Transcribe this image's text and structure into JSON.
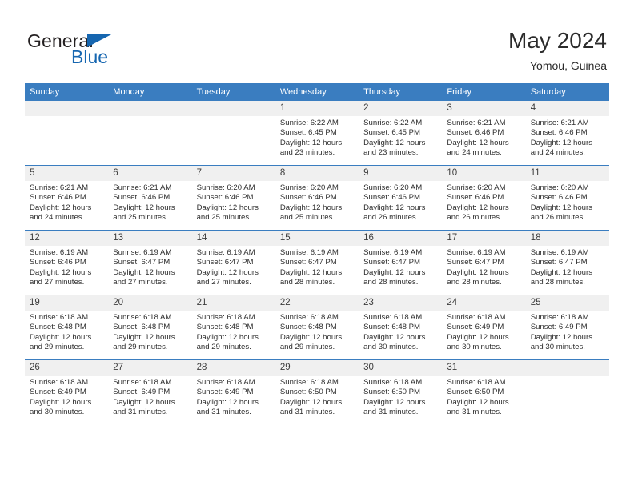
{
  "brand": {
    "name_part1": "General",
    "name_part2": "Blue",
    "color_dark": "#231f20",
    "color_blue": "#1666b0"
  },
  "header": {
    "title": "May 2024",
    "subtitle": "Yomou, Guinea"
  },
  "theme": {
    "header_blue": "#3a7dc0",
    "daynum_gray": "#f0f0f0",
    "text": "#2e2e2e"
  },
  "weekday_headers": [
    "Sunday",
    "Monday",
    "Tuesday",
    "Wednesday",
    "Thursday",
    "Friday",
    "Saturday"
  ],
  "weeks": [
    [
      {
        "day": "",
        "empty": true
      },
      {
        "day": "",
        "empty": true
      },
      {
        "day": "",
        "empty": true
      },
      {
        "day": "1",
        "sunrise": "Sunrise: 6:22 AM",
        "sunset": "Sunset: 6:45 PM",
        "daylight1": "Daylight: 12 hours",
        "daylight2": "and 23 minutes."
      },
      {
        "day": "2",
        "sunrise": "Sunrise: 6:22 AM",
        "sunset": "Sunset: 6:45 PM",
        "daylight1": "Daylight: 12 hours",
        "daylight2": "and 23 minutes."
      },
      {
        "day": "3",
        "sunrise": "Sunrise: 6:21 AM",
        "sunset": "Sunset: 6:46 PM",
        "daylight1": "Daylight: 12 hours",
        "daylight2": "and 24 minutes."
      },
      {
        "day": "4",
        "sunrise": "Sunrise: 6:21 AM",
        "sunset": "Sunset: 6:46 PM",
        "daylight1": "Daylight: 12 hours",
        "daylight2": "and 24 minutes."
      }
    ],
    [
      {
        "day": "5",
        "sunrise": "Sunrise: 6:21 AM",
        "sunset": "Sunset: 6:46 PM",
        "daylight1": "Daylight: 12 hours",
        "daylight2": "and 24 minutes."
      },
      {
        "day": "6",
        "sunrise": "Sunrise: 6:21 AM",
        "sunset": "Sunset: 6:46 PM",
        "daylight1": "Daylight: 12 hours",
        "daylight2": "and 25 minutes."
      },
      {
        "day": "7",
        "sunrise": "Sunrise: 6:20 AM",
        "sunset": "Sunset: 6:46 PM",
        "daylight1": "Daylight: 12 hours",
        "daylight2": "and 25 minutes."
      },
      {
        "day": "8",
        "sunrise": "Sunrise: 6:20 AM",
        "sunset": "Sunset: 6:46 PM",
        "daylight1": "Daylight: 12 hours",
        "daylight2": "and 25 minutes."
      },
      {
        "day": "9",
        "sunrise": "Sunrise: 6:20 AM",
        "sunset": "Sunset: 6:46 PM",
        "daylight1": "Daylight: 12 hours",
        "daylight2": "and 26 minutes."
      },
      {
        "day": "10",
        "sunrise": "Sunrise: 6:20 AM",
        "sunset": "Sunset: 6:46 PM",
        "daylight1": "Daylight: 12 hours",
        "daylight2": "and 26 minutes."
      },
      {
        "day": "11",
        "sunrise": "Sunrise: 6:20 AM",
        "sunset": "Sunset: 6:46 PM",
        "daylight1": "Daylight: 12 hours",
        "daylight2": "and 26 minutes."
      }
    ],
    [
      {
        "day": "12",
        "sunrise": "Sunrise: 6:19 AM",
        "sunset": "Sunset: 6:46 PM",
        "daylight1": "Daylight: 12 hours",
        "daylight2": "and 27 minutes."
      },
      {
        "day": "13",
        "sunrise": "Sunrise: 6:19 AM",
        "sunset": "Sunset: 6:47 PM",
        "daylight1": "Daylight: 12 hours",
        "daylight2": "and 27 minutes."
      },
      {
        "day": "14",
        "sunrise": "Sunrise: 6:19 AM",
        "sunset": "Sunset: 6:47 PM",
        "daylight1": "Daylight: 12 hours",
        "daylight2": "and 27 minutes."
      },
      {
        "day": "15",
        "sunrise": "Sunrise: 6:19 AM",
        "sunset": "Sunset: 6:47 PM",
        "daylight1": "Daylight: 12 hours",
        "daylight2": "and 28 minutes."
      },
      {
        "day": "16",
        "sunrise": "Sunrise: 6:19 AM",
        "sunset": "Sunset: 6:47 PM",
        "daylight1": "Daylight: 12 hours",
        "daylight2": "and 28 minutes."
      },
      {
        "day": "17",
        "sunrise": "Sunrise: 6:19 AM",
        "sunset": "Sunset: 6:47 PM",
        "daylight1": "Daylight: 12 hours",
        "daylight2": "and 28 minutes."
      },
      {
        "day": "18",
        "sunrise": "Sunrise: 6:19 AM",
        "sunset": "Sunset: 6:47 PM",
        "daylight1": "Daylight: 12 hours",
        "daylight2": "and 28 minutes."
      }
    ],
    [
      {
        "day": "19",
        "sunrise": "Sunrise: 6:18 AM",
        "sunset": "Sunset: 6:48 PM",
        "daylight1": "Daylight: 12 hours",
        "daylight2": "and 29 minutes."
      },
      {
        "day": "20",
        "sunrise": "Sunrise: 6:18 AM",
        "sunset": "Sunset: 6:48 PM",
        "daylight1": "Daylight: 12 hours",
        "daylight2": "and 29 minutes."
      },
      {
        "day": "21",
        "sunrise": "Sunrise: 6:18 AM",
        "sunset": "Sunset: 6:48 PM",
        "daylight1": "Daylight: 12 hours",
        "daylight2": "and 29 minutes."
      },
      {
        "day": "22",
        "sunrise": "Sunrise: 6:18 AM",
        "sunset": "Sunset: 6:48 PM",
        "daylight1": "Daylight: 12 hours",
        "daylight2": "and 29 minutes."
      },
      {
        "day": "23",
        "sunrise": "Sunrise: 6:18 AM",
        "sunset": "Sunset: 6:48 PM",
        "daylight1": "Daylight: 12 hours",
        "daylight2": "and 30 minutes."
      },
      {
        "day": "24",
        "sunrise": "Sunrise: 6:18 AM",
        "sunset": "Sunset: 6:49 PM",
        "daylight1": "Daylight: 12 hours",
        "daylight2": "and 30 minutes."
      },
      {
        "day": "25",
        "sunrise": "Sunrise: 6:18 AM",
        "sunset": "Sunset: 6:49 PM",
        "daylight1": "Daylight: 12 hours",
        "daylight2": "and 30 minutes."
      }
    ],
    [
      {
        "day": "26",
        "sunrise": "Sunrise: 6:18 AM",
        "sunset": "Sunset: 6:49 PM",
        "daylight1": "Daylight: 12 hours",
        "daylight2": "and 30 minutes."
      },
      {
        "day": "27",
        "sunrise": "Sunrise: 6:18 AM",
        "sunset": "Sunset: 6:49 PM",
        "daylight1": "Daylight: 12 hours",
        "daylight2": "and 31 minutes."
      },
      {
        "day": "28",
        "sunrise": "Sunrise: 6:18 AM",
        "sunset": "Sunset: 6:49 PM",
        "daylight1": "Daylight: 12 hours",
        "daylight2": "and 31 minutes."
      },
      {
        "day": "29",
        "sunrise": "Sunrise: 6:18 AM",
        "sunset": "Sunset: 6:50 PM",
        "daylight1": "Daylight: 12 hours",
        "daylight2": "and 31 minutes."
      },
      {
        "day": "30",
        "sunrise": "Sunrise: 6:18 AM",
        "sunset": "Sunset: 6:50 PM",
        "daylight1": "Daylight: 12 hours",
        "daylight2": "and 31 minutes."
      },
      {
        "day": "31",
        "sunrise": "Sunrise: 6:18 AM",
        "sunset": "Sunset: 6:50 PM",
        "daylight1": "Daylight: 12 hours",
        "daylight2": "and 31 minutes."
      },
      {
        "day": "",
        "empty": true
      }
    ]
  ]
}
